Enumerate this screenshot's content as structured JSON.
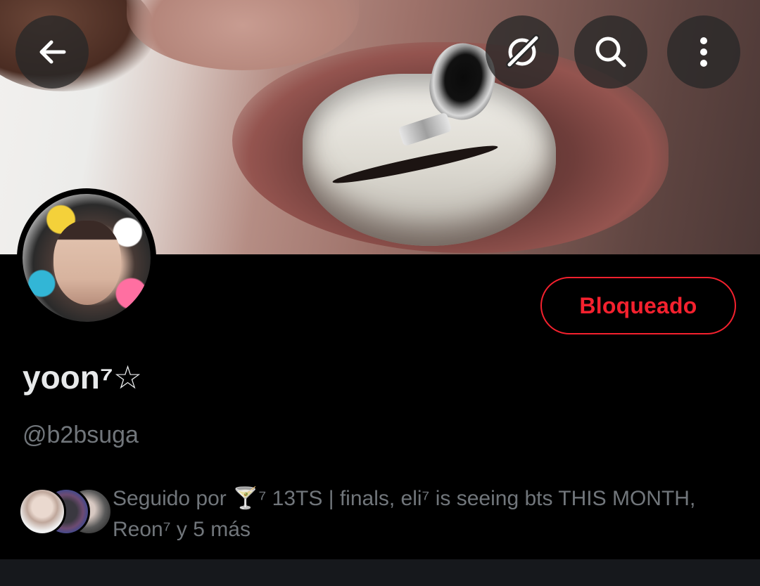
{
  "header": {
    "back_icon": "arrow-left-icon",
    "grok_icon": "grok-slash-icon",
    "search_icon": "search-icon",
    "more_icon": "more-vertical-icon"
  },
  "profile": {
    "name": "yoon⁷☆",
    "handle": "@b2bsuga",
    "block_button_label": "Bloqueado",
    "followed_by_text": "Seguido por 🍸⁷ 13TS | finals, eli⁷ is seeing bts THIS MONTH, Reon⁷ y 5 más"
  },
  "colors": {
    "background": "#000000",
    "name": "#e7e9ea",
    "secondary_text": "#71767b",
    "block_red": "#f4212e"
  }
}
